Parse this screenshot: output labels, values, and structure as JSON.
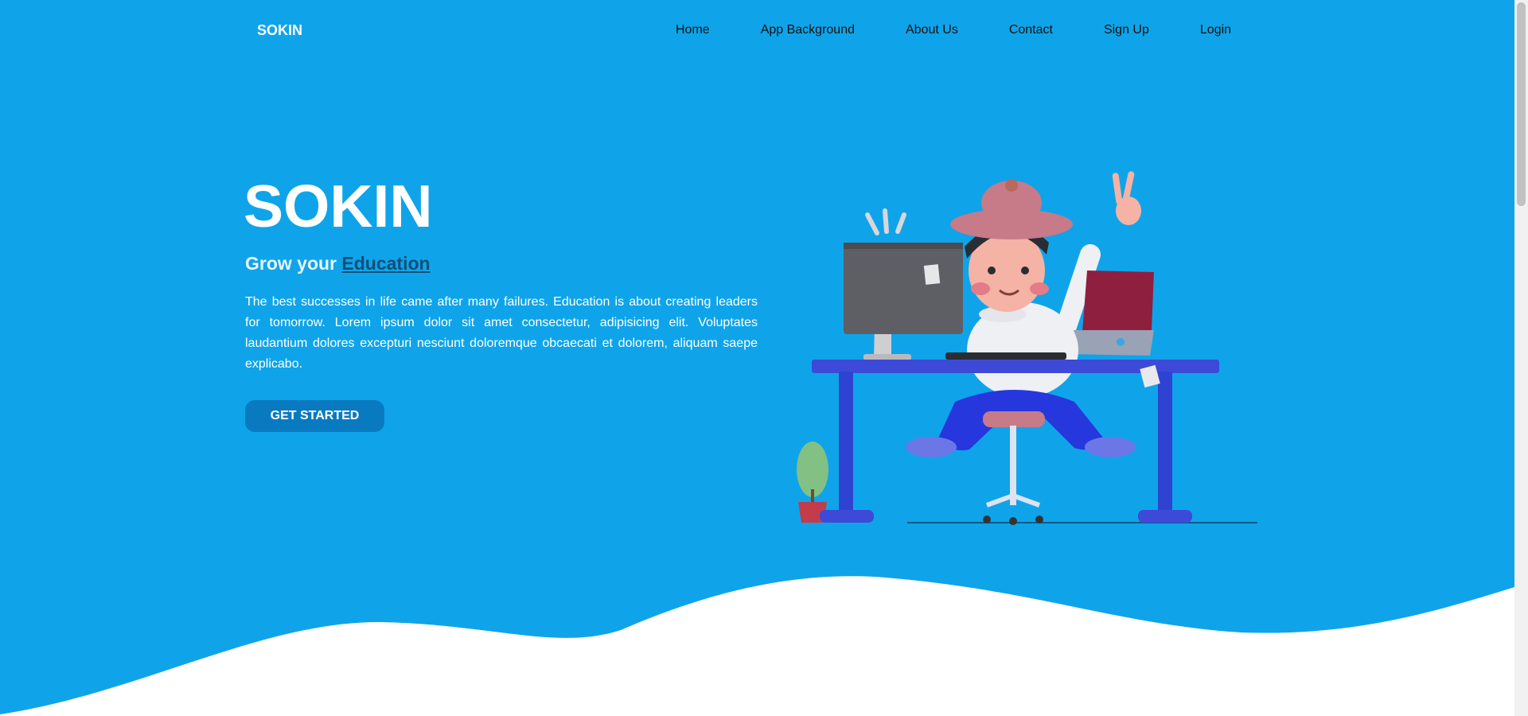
{
  "nav": {
    "brand": "SOKIN",
    "items": [
      {
        "label": "Home"
      },
      {
        "label": "App Background"
      },
      {
        "label": "About Us"
      },
      {
        "label": "Contact"
      },
      {
        "label": "Sign Up"
      },
      {
        "label": "Login"
      }
    ]
  },
  "hero": {
    "title": "SOKIN",
    "subtitle_prefix": "Grow your",
    "subtitle_highlight": "Education",
    "body": "The best successes in life came after many failures. Education is about creating leaders for tomorrow. Lorem ipsum dolor sit amet consectetur, adipisicing elit. Voluptates laudantium dolores excepturi nesciunt doloremque obcaecati et dolorem, aliquam saepe explicabo.",
    "cta_label": "GET STARTED"
  },
  "colors": {
    "background": "#0fa4e9",
    "button": "#0a7ac0",
    "highlight": "#114e78",
    "wave": "#ffffff"
  },
  "icons": {
    "illustration": "person-at-desk-illustration"
  }
}
